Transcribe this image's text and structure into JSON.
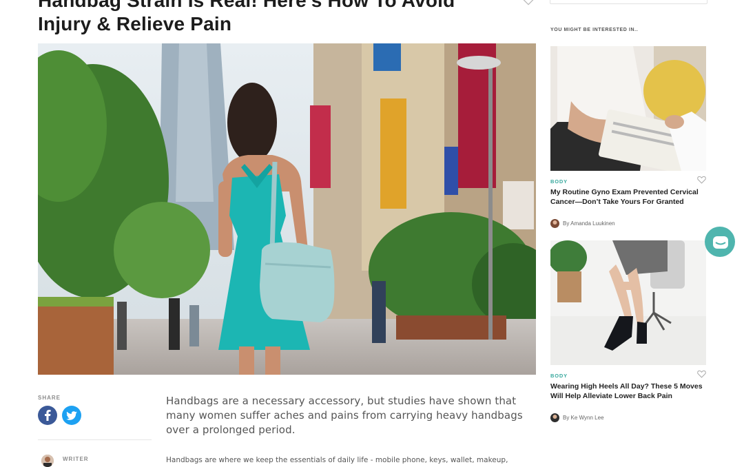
{
  "article": {
    "title_line1": "Handbag Strain Is Real! Here's How To Avoid",
    "title_line2": "Injury & Relieve Pain",
    "lead": "Handbags are a necessary accessory, but studies have shown that many women suffer aches and pains from carrying heavy handbags over a prolonged period.",
    "body_start": "Handbags are where we keep the essentials of daily life - mobile phone, keys, wallet, makeup,"
  },
  "share": {
    "label": "SHARE",
    "facebook_icon": "facebook-icon",
    "twitter_icon": "twitter-icon"
  },
  "writer": {
    "label": "WRITER"
  },
  "sidebar": {
    "heading": "YOU MIGHT BE INTERESTED IN..",
    "cards": [
      {
        "category": "BODY",
        "title": "My Routine Gyno Exam Prevented Cervical Cancer—Don’t Take Yours For Granted",
        "author": "By Amanda Luukinen"
      },
      {
        "category": "BODY",
        "title": "Wearing High Heels All Day? These 5 Moves Will Help Alleviate Lower Back Pain",
        "author": "By Ke Wynn Lee"
      }
    ]
  },
  "colors": {
    "accent": "#39a99e",
    "facebook": "#3b5998",
    "twitter": "#1da1f2",
    "chat": "#4fb5ae"
  }
}
